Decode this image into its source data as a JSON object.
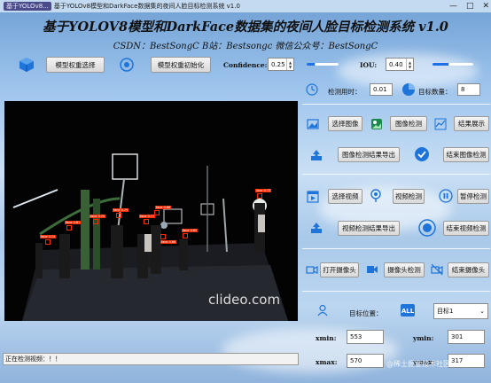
{
  "window": {
    "app_name": "基于YOLOv8...",
    "title": "基于YOLOv8模型和DarkFace数据集的夜间人脸目标检测系统 v1.0",
    "buttons": [
      "—",
      "□",
      "✕"
    ]
  },
  "header": {
    "title": "基于YOLOV8模型和DarkFace数据集的夜间人脸目标检测系统 v1.0",
    "subtitle": "CSDN：BestSongC   B站：Bestsongc   微信公众号：BestSongC"
  },
  "model": {
    "select_label": "模型权重选择",
    "init_label": "模型权重初始化"
  },
  "params": {
    "confidence_label": "Confidence:",
    "confidence_value": "0.25",
    "confidence_fraction": 0.25,
    "iou_label": "IOU:",
    "iou_value": "0.40",
    "iou_fraction": 0.4
  },
  "stats": {
    "time_label": "检测用时：",
    "time_value": "0.01",
    "count_label": "目标数量：",
    "count_value": "8"
  },
  "image_section": {
    "select": "选择图像",
    "detect": "图像检测",
    "show": "结果展示",
    "export": "图像检测结果导出",
    "end": "结束图像检测"
  },
  "video_section": {
    "select": "选择视频",
    "detect": "视频检测",
    "pause": "暂停检测",
    "export": "视频检测结果导出",
    "end": "结束视频检测"
  },
  "camera_section": {
    "open": "打开摄像头",
    "detect": "摄像头检测",
    "end": "结束摄像头"
  },
  "target": {
    "position_label": "目标位置：",
    "selected": "目标1",
    "xmin_label": "xmin:",
    "xmin_value": "553",
    "ymin_label": "ymin:",
    "ymin_value": "301",
    "xmax_label": "xmax:",
    "xmax_value": "570",
    "ymax_label": "ymax:",
    "ymax_value": "317"
  },
  "video": {
    "watermark": "clideo.com",
    "face_label": "face",
    "detections": [
      "face 0.74",
      "face 0.81",
      "face 0.79",
      "face 0.77",
      "face 0.68",
      "face 0.65",
      "face 0.72",
      "face 0.70",
      "face 0.66"
    ]
  },
  "status": {
    "text": "正在检测视频：！！"
  },
  "footer": {
    "watermark": "@稀土掘金技术社区"
  },
  "colors": {
    "accent": "#1f6fe5",
    "detection": "#ff2a00"
  }
}
